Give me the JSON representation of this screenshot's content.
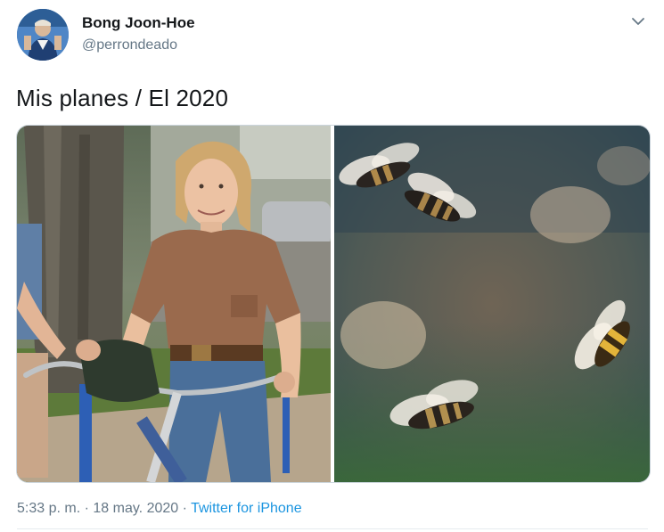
{
  "user": {
    "display_name": "Bong Joon-Hoe",
    "handle": "@perrondeado"
  },
  "tweet": {
    "text": "Mis planes / El 2020",
    "media": [
      {
        "kind": "photo",
        "subject": "girl-on-bicycle"
      },
      {
        "kind": "photo",
        "subject": "swarm-of-bees"
      }
    ]
  },
  "meta": {
    "time": "5:33 p. m.",
    "separator": "·",
    "date": "18 may. 2020",
    "source": "Twitter for iPhone"
  },
  "icons": {
    "menu": "chevron-down-icon"
  },
  "colors": {
    "link": "#1b95e0",
    "secondary_text": "#657786",
    "border": "#ccd6dd"
  }
}
